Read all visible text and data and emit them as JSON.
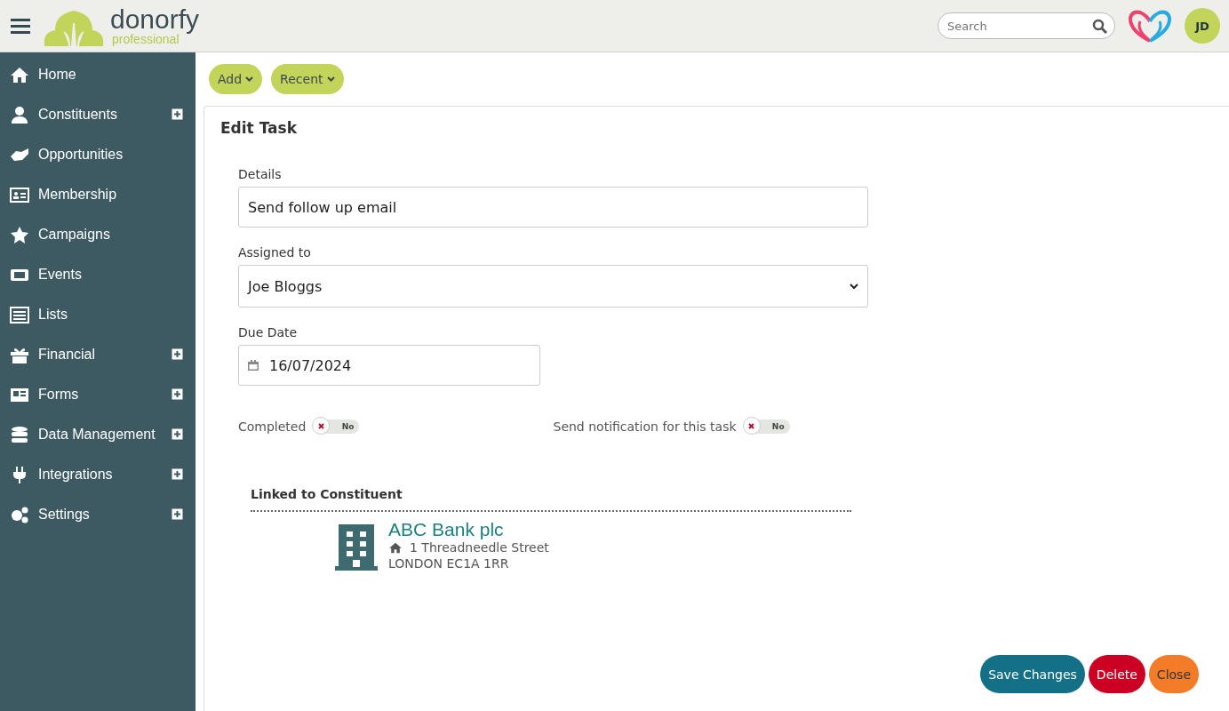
{
  "header": {
    "logo": {
      "name": "donorfy",
      "tagline": "professional"
    },
    "search": {
      "placeholder": "Search"
    },
    "avatar": "JD"
  },
  "sidebar": {
    "items": [
      {
        "label": "Home",
        "expandable": false
      },
      {
        "label": "Constituents",
        "expandable": true
      },
      {
        "label": "Opportunities",
        "expandable": false
      },
      {
        "label": "Membership",
        "expandable": false
      },
      {
        "label": "Campaigns",
        "expandable": false
      },
      {
        "label": "Events",
        "expandable": false
      },
      {
        "label": "Lists",
        "expandable": false
      },
      {
        "label": "Financial",
        "expandable": true
      },
      {
        "label": "Forms",
        "expandable": true
      },
      {
        "label": "Data Management",
        "expandable": true
      },
      {
        "label": "Integrations",
        "expandable": true
      },
      {
        "label": "Settings",
        "expandable": true
      }
    ]
  },
  "toolbar": [
    "Add",
    "Recent"
  ],
  "panel": {
    "title": "Edit Task",
    "details": {
      "label": "Details",
      "value": "Send follow up email"
    },
    "assigned_to": {
      "label": "Assigned to",
      "value": "Joe Bloggs"
    },
    "due_date": {
      "label": "Due Date",
      "value": "16/07/2024"
    },
    "toggles": [
      {
        "label": "Completed",
        "on": false,
        "state_text": "No"
      },
      {
        "label": "Send notification for this task",
        "on": false,
        "state_text": "No"
      }
    ],
    "linked": {
      "heading": "Linked to Constituent",
      "name": "ABC Bank plc",
      "address_line": "1 Threadneedle Street",
      "city_line": "LONDON EC1A 1RR"
    },
    "buttons": [
      {
        "label": "Save Changes",
        "kind": "primary"
      },
      {
        "label": "Delete",
        "kind": "danger"
      },
      {
        "label": "Close",
        "kind": "warning"
      }
    ]
  }
}
